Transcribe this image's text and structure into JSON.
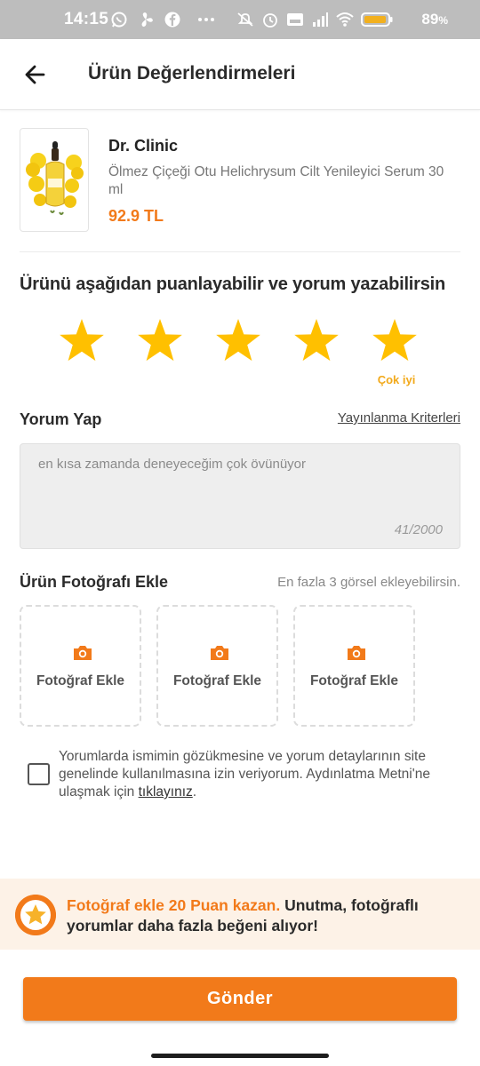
{
  "status_bar": {
    "time": "14:15",
    "battery_percent": "89",
    "battery_unit": "%",
    "icons_left": [
      "whatsapp-icon",
      "fan-icon",
      "facebook-icon",
      "more-dots-icon"
    ],
    "icons_right": [
      "mute-icon",
      "alarm-icon",
      "volte-icon",
      "signal-icon",
      "wifi-icon",
      "battery-icon"
    ]
  },
  "header": {
    "title": "Ürün Değerlendirmeleri",
    "back_icon": "arrow-left-icon"
  },
  "product": {
    "brand": "Dr. Clinic",
    "name": "Ölmez Çiçeği Otu Helichrysum Cilt Yenileyici Serum 30 ml",
    "price": "92.9 TL"
  },
  "rating": {
    "heading": "Ürünü aşağıdan puanlayabilir ve yorum yazabilirsin",
    "value": 5,
    "max": 5,
    "caption": "Çok iyi",
    "color": "#ffc000"
  },
  "comment": {
    "label": "Yorum Yap",
    "criteria_link": "Yayınlanma Kriterleri",
    "text": "en kısa zamanda deneyeceğim çok övünüyor",
    "count": "41/2000"
  },
  "photos": {
    "label": "Ürün Fotoğrafı Ekle",
    "hint": "En fazla 3 görsel ekleyebilirsin.",
    "slots": [
      {
        "label": "Fotoğraf Ekle"
      },
      {
        "label": "Fotoğraf Ekle"
      },
      {
        "label": "Fotoğraf Ekle"
      }
    ]
  },
  "consent": {
    "text": "Yorumlarda ismimin gözükmesine ve yorum detaylarının site genelinde kullanılmasına izin veriyorum. Aydınlatma Metni'ne ulaşmak için ",
    "link": "tıklayınız",
    "suffix": ".",
    "checked": false
  },
  "promo": {
    "highlight": "Fotoğraf ekle 20 Puan kazan.",
    "text": " Unutma, fotoğraflı yorumlar daha fazla beğeni alıyor!"
  },
  "submit": {
    "label": "Gönder"
  },
  "colors": {
    "accent": "#f27a1a",
    "star": "#ffc000",
    "promo_bg": "#fdf2e7"
  }
}
